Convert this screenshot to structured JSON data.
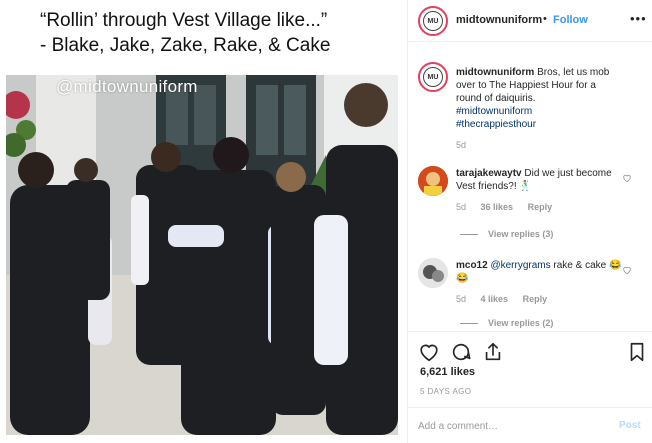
{
  "image": {
    "caption_line1": "“Rollin’ through Vest Village like...”",
    "caption_line2": "- Blake, Jake, Zake, Rake, & Cake",
    "watermark": "@midtownuniform"
  },
  "header": {
    "username": "midtownuniform",
    "separator": "•",
    "follow_label": "Follow",
    "more_icon": "more-horizontal-icon"
  },
  "caption": {
    "username": "midtownuniform",
    "text": "Bros, let us mob over to The Happiest Hour for a round of daiquiris.",
    "hashtag1": "#midtownuniform",
    "hashtag2": "#thecrappiesthour",
    "age": "5d"
  },
  "comments": [
    {
      "username": "tarajakewaytv",
      "text": "Did we just become Vest friends?!",
      "emoji": "🕺",
      "age": "5d",
      "likes": "36 likes",
      "reply_label": "Reply",
      "view_replies": "View replies (3)"
    },
    {
      "username": "mco12",
      "mention": "@kerrygrams",
      "text": "rake & cake",
      "emoji": "😂😂",
      "age": "5d",
      "likes": "4 likes",
      "reply_label": "Reply",
      "view_replies": "View replies (2)"
    }
  ],
  "actions": {
    "icons": [
      "heart-icon",
      "comment-icon",
      "share-icon",
      "bookmark-icon"
    ],
    "likes": "6,621 likes",
    "date": "5 DAYS AGO"
  },
  "comment_box": {
    "placeholder": "Add a comment…",
    "post_label": "Post",
    "post_color": "#b2dffc"
  },
  "colors": {
    "link": "#3897f0",
    "hashtag": "#003569",
    "avatar_ring": "#e53f5f"
  }
}
